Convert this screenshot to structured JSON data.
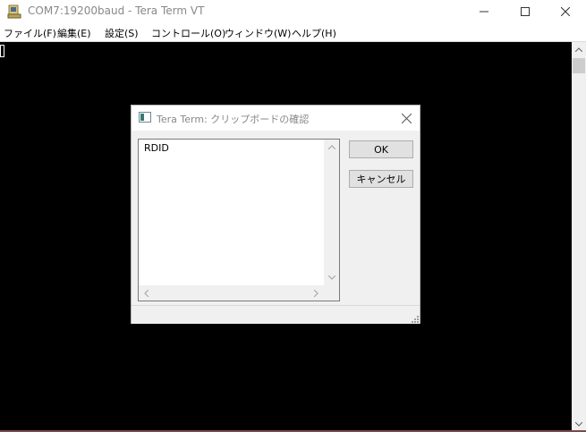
{
  "window": {
    "title": "COM7:19200baud - Tera Term VT",
    "icon": "tera-term-app-icon"
  },
  "menu": [
    {
      "label": "ファイル(F)"
    },
    {
      "label": "編集(E)"
    },
    {
      "label": "設定(S)"
    },
    {
      "label": "コントロール(O)"
    },
    {
      "label": "ウィンドウ(W)"
    },
    {
      "label": "ヘルプ(H)"
    }
  ],
  "dialog": {
    "title": "Tera Term: クリップボードの確認",
    "clipboard_text": "RDID",
    "ok_label": "OK",
    "cancel_label": "キャンセル"
  },
  "colors": {
    "terminal_bg": "#000000",
    "dialog_bg": "#f0f0f0",
    "button_bg": "#e1e1e1"
  }
}
